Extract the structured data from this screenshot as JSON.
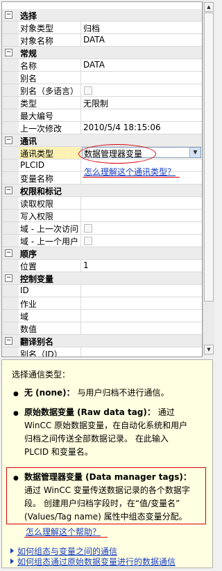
{
  "sections": {
    "selection": "选择",
    "general": "常规",
    "communication": "通讯",
    "authorization": "权限和标记",
    "order": "顺序",
    "control": "控制变量",
    "translation": "翻译别名"
  },
  "props": {
    "object_type": {
      "name": "对象类型",
      "value": "归档"
    },
    "object_name": {
      "name": "对象名称",
      "value": "DATA"
    },
    "name": {
      "name": "名称",
      "value": "DATA"
    },
    "alias": {
      "name": "别名",
      "value": ""
    },
    "alias_ml": {
      "name": "别名（多语言）"
    },
    "type": {
      "name": "类型",
      "value": "无限制"
    },
    "max_number": {
      "name": "最大编号",
      "value": ""
    },
    "last_modified": {
      "name": "上一次修改",
      "value": "2010/5/4 18:15:06"
    },
    "comm_type": {
      "name": "通讯类型",
      "value": "数据管理器变量"
    },
    "plcid": {
      "name": "PLCID",
      "value": ""
    },
    "tag_name": {
      "name": "变量名称",
      "value": ""
    },
    "read_access": {
      "name": "读取权限",
      "value": ""
    },
    "write_access": {
      "name": "写入权限",
      "value": ""
    },
    "field_last_access": {
      "name": "域 - 上一次访问"
    },
    "field_last_user": {
      "name": "域 - 上一个用户"
    },
    "position": {
      "name": "位置",
      "value": "1"
    },
    "ctrl_id": {
      "name": "ID",
      "value": ""
    },
    "ctrl_job": {
      "name": "作业",
      "value": ""
    },
    "ctrl_field": {
      "name": "域",
      "value": ""
    },
    "ctrl_value": {
      "name": "数值",
      "value": ""
    },
    "alias_id": {
      "name": "别名（ID）",
      "value": ""
    }
  },
  "annotation": {
    "link": "怎么理解这个通讯类型？"
  },
  "help": {
    "intro": "选择通信类型：",
    "b1_title": "无 (none)：",
    "b1_text": "与用户归档不进行通信。",
    "b2_title": "原始数据变量 (Raw data tag)：",
    "b2_l1": "通过",
    "b2_l2": "WinCC 原始数据变量，在自动化系统和用户",
    "b2_l3": "归档之间传送全部数据记录。 在此输入",
    "b2_l4": "PLCID 和变量名。",
    "b3_title": "数据管理器变量 (Data manager tags)：",
    "b3_l1": "通过 WinCC 变量传送数据记录的各个数据字",
    "b3_l2": "段。 创建用户归档字段时，在“值/变量名”",
    "b3_l3": "(Values/Tag name) 属性中组态变量分配。",
    "box_link": "怎么理解这个帮助？",
    "link1": "如何组态与变量之间的通信",
    "link2": "如何组态通过原始数据变量进行的数据通信"
  },
  "colors": {
    "annotation_red": "#d8000a",
    "link_blue": "#1b3fc4",
    "help_bg": "#ffffe1",
    "selected_name_bg": "#fdf2b4"
  },
  "icons": {
    "collapse": "minus-box-icon",
    "dropdown": "chevron-down-icon",
    "link": "arrow-right-icon",
    "scroll_up": "arrow-up-icon",
    "scroll_down": "arrow-down-icon"
  }
}
